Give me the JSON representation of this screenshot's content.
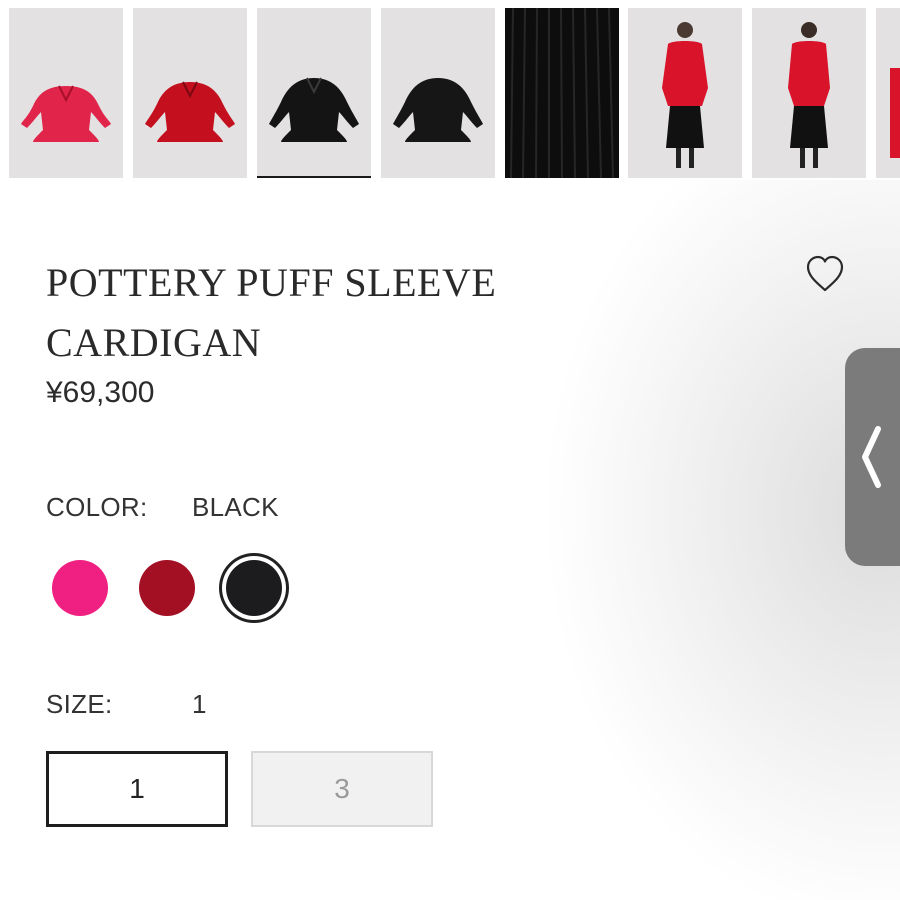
{
  "product": {
    "title": "POTTERY PUFF SLEEVE CARDIGAN",
    "price": "¥69,300"
  },
  "thumbnails": [
    {
      "name": "pink-cardigan",
      "color": "#e0244a"
    },
    {
      "name": "red-cardigan",
      "color": "#c4101e"
    },
    {
      "name": "black-cardigan-front",
      "color": "#141414",
      "selected": true
    },
    {
      "name": "black-cardigan-back",
      "color": "#141414"
    },
    {
      "name": "black-knit-detail",
      "color": "#0c0c0c"
    },
    {
      "name": "model-front",
      "color": "#d8132a"
    },
    {
      "name": "model-back",
      "color": "#d8132a"
    },
    {
      "name": "model-partial",
      "color": "#d8132a"
    }
  ],
  "color_option": {
    "label": "COLOR:",
    "selected_value": "BLACK",
    "swatches": [
      {
        "name": "pink",
        "hex": "#f02082"
      },
      {
        "name": "burgundy",
        "hex": "#a30f23"
      },
      {
        "name": "black",
        "hex": "#1c1c1e",
        "selected": true
      }
    ]
  },
  "size_option": {
    "label": "SIZE:",
    "selected_value": "1",
    "sizes": [
      {
        "label": "1",
        "state": "active"
      },
      {
        "label": "3",
        "state": "disabled"
      }
    ]
  },
  "icons": {
    "wishlist": "heart-outline-icon",
    "side_tab": "chevron-left-icon"
  }
}
